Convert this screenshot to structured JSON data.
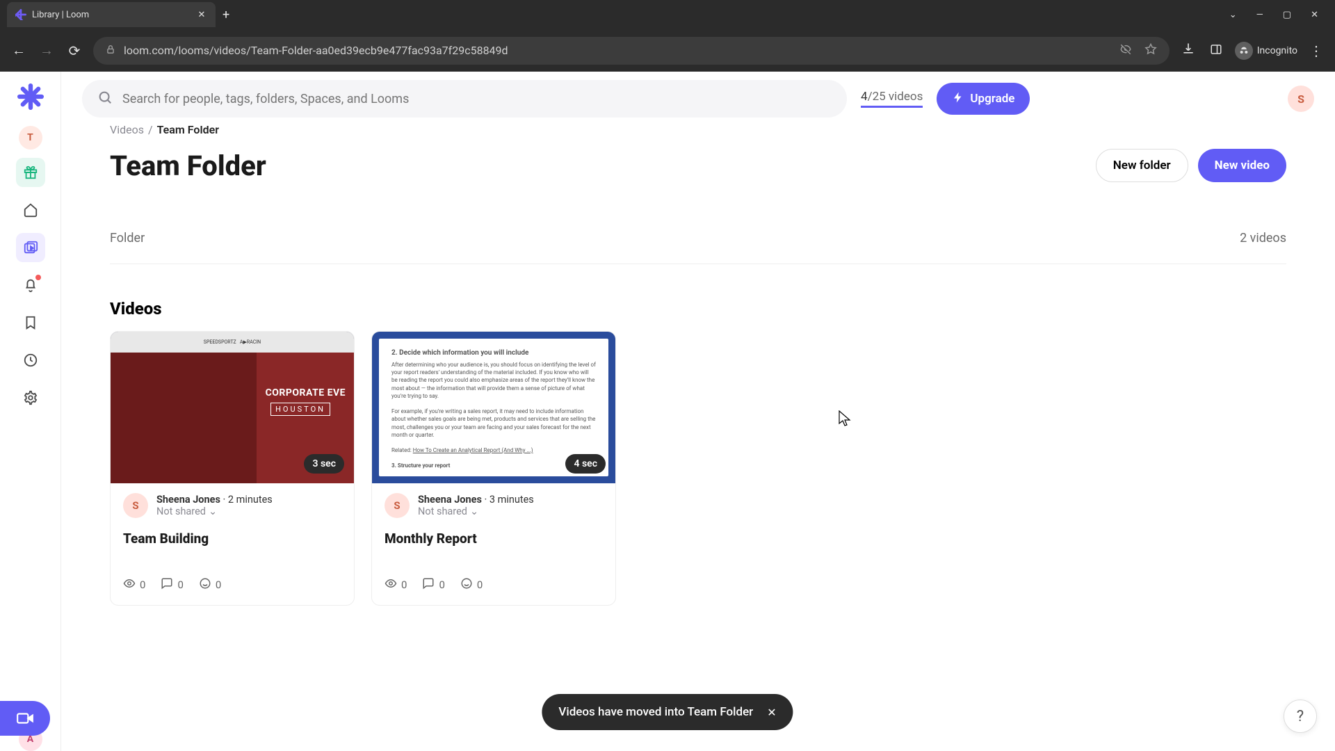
{
  "browser": {
    "tab_title": "Library | Loom",
    "url": "loom.com/looms/videos/Team-Folder-aa0ed39ecb9e477fac93a7f29c58849d",
    "incognito_label": "Incognito"
  },
  "search": {
    "placeholder": "Search for people, tags, folders, Spaces, and Looms"
  },
  "header": {
    "video_count_used": "4",
    "video_count_text": "/25 videos",
    "upgrade_label": "Upgrade",
    "avatar_initial": "S"
  },
  "sidebar": {
    "workspace_initial": "T",
    "extra_avatar": "A"
  },
  "breadcrumb": {
    "root": "Videos",
    "sep": "/",
    "current": "Team Folder"
  },
  "folder": {
    "title": "Team Folder",
    "new_folder": "New folder",
    "new_video": "New video",
    "section_label": "Folder",
    "count": "2 videos"
  },
  "videos_heading": "Videos",
  "cards": [
    {
      "duration": "3 sec",
      "avatar": "S",
      "author": "Sheena Jones",
      "age": "2 minutes",
      "share": "Not shared",
      "title": "Team Building",
      "views": "0",
      "comments": "0",
      "reactions": "0",
      "thumb_line1": "CORPORATE EVE",
      "thumb_line2": "HOUSTON"
    },
    {
      "duration": "4 sec",
      "avatar": "S",
      "author": "Sheena Jones",
      "age": "3 minutes",
      "share": "Not shared",
      "title": "Monthly Report",
      "views": "0",
      "comments": "0",
      "reactions": "0",
      "doc_heading": "2. Decide which information you will include"
    }
  ],
  "toast": {
    "text": "Videos have moved into Team Folder"
  }
}
